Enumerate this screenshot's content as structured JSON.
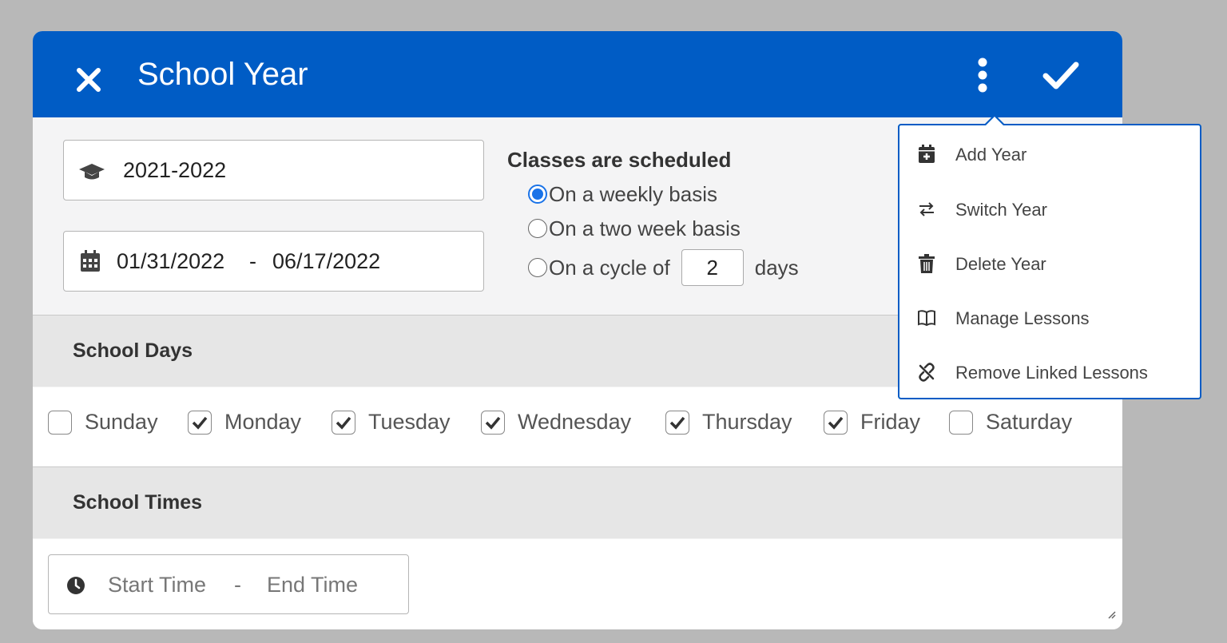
{
  "header": {
    "title": "School Year"
  },
  "year_field": {
    "value": "2021-2022"
  },
  "date_field": {
    "start": "01/31/2022",
    "separator": "-",
    "end": "06/17/2022"
  },
  "schedule": {
    "title": "Classes are scheduled",
    "options": [
      {
        "label": "On a weekly basis",
        "selected": true
      },
      {
        "label": "On a two week basis",
        "selected": false
      },
      {
        "label": "On a cycle of",
        "selected": false
      }
    ],
    "cycle_value": "2",
    "cycle_unit": "days"
  },
  "school_days": {
    "title": "School Days",
    "days": [
      {
        "label": "Sunday",
        "checked": false
      },
      {
        "label": "Monday",
        "checked": true
      },
      {
        "label": "Tuesday",
        "checked": true
      },
      {
        "label": "Wednesday",
        "checked": true
      },
      {
        "label": "Thursday",
        "checked": true
      },
      {
        "label": "Friday",
        "checked": true
      },
      {
        "label": "Saturday",
        "checked": false
      }
    ]
  },
  "school_times": {
    "title": "School Times",
    "start_placeholder": "Start Time",
    "separator": "-",
    "end_placeholder": "End Time"
  },
  "menu": {
    "items": [
      {
        "label": "Add Year",
        "icon": "calendar-plus-icon"
      },
      {
        "label": "Switch Year",
        "icon": "switch-arrows-icon"
      },
      {
        "label": "Delete Year",
        "icon": "trash-icon"
      },
      {
        "label": "Manage Lessons",
        "icon": "book-open-icon"
      },
      {
        "label": "Remove Linked Lessons",
        "icon": "unlink-icon"
      }
    ]
  },
  "colors": {
    "primary": "#005cc5",
    "radio_accent": "#1a73e8",
    "section_bg": "#e6e6e6"
  }
}
